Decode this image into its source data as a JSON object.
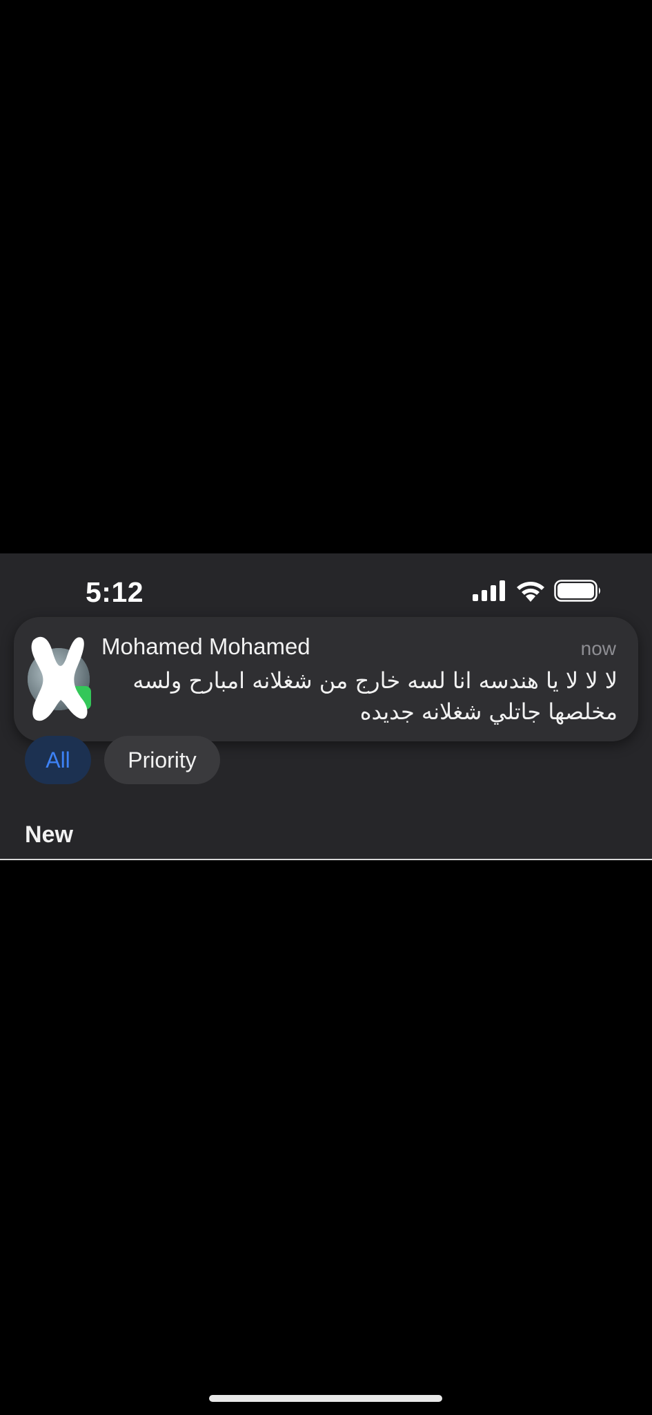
{
  "status_bar": {
    "time": "5:12",
    "icons": [
      "cellular-signal-icon",
      "wifi-icon",
      "battery-icon"
    ]
  },
  "notification": {
    "sender": "Mohamed Mohamed",
    "time": "now",
    "message": "لا لا لا يا هندسه انا لسه خارج من شغلانه امبارح ولسه مخلصها جاتلي شغلانه جديده",
    "avatar_icon": "redacted-avatar-icon",
    "app_badge_icon": "messages-app-badge-icon"
  },
  "filters": {
    "all_label": "All",
    "priority_label": "Priority",
    "active": "All"
  },
  "section": {
    "title": "New"
  },
  "colors": {
    "background": "#000000",
    "panel": "#262629",
    "notification_bg": "#2f2f32",
    "accent_blue": "#3d82f6",
    "badge_green": "#34c759"
  }
}
